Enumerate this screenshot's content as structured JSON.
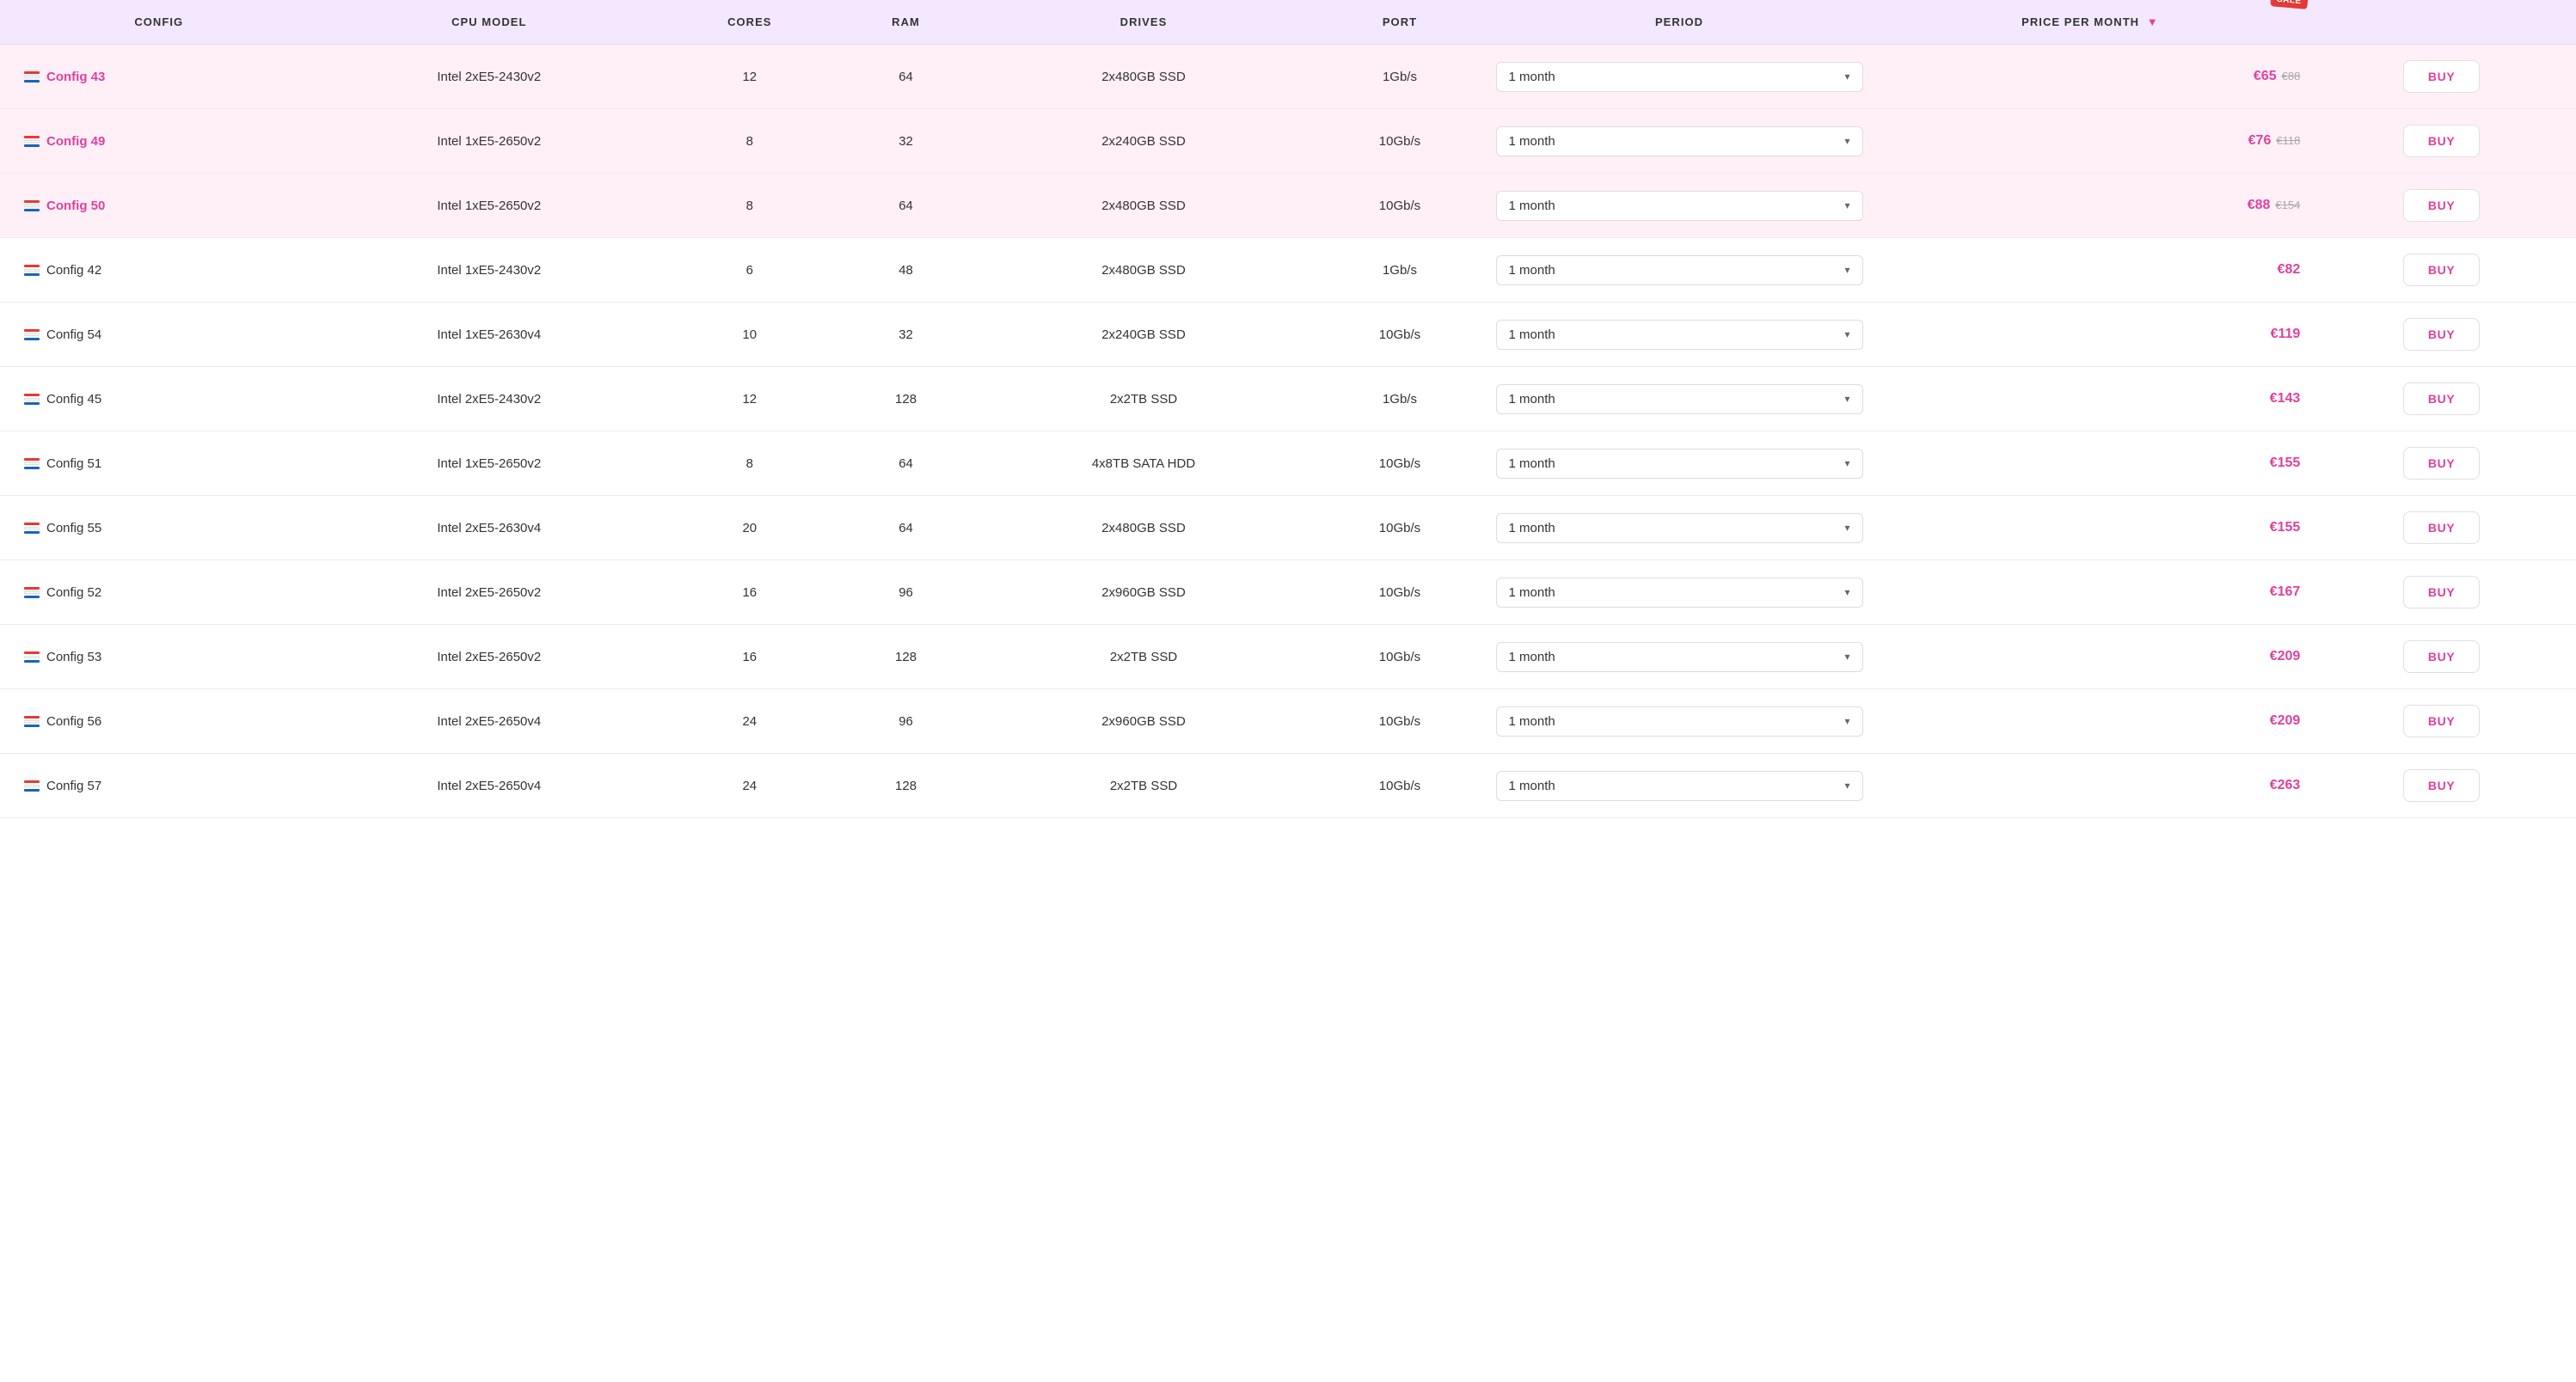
{
  "table": {
    "columns": [
      {
        "key": "config",
        "label": "CONFIG",
        "sortable": false
      },
      {
        "key": "cpu_model",
        "label": "CPU MODEL",
        "sortable": false
      },
      {
        "key": "cores",
        "label": "CORES",
        "sortable": false
      },
      {
        "key": "ram",
        "label": "RAM",
        "sortable": false
      },
      {
        "key": "drives",
        "label": "DRIVES",
        "sortable": false
      },
      {
        "key": "port",
        "label": "PORT",
        "sortable": false
      },
      {
        "key": "period",
        "label": "PERIOD",
        "sortable": false
      },
      {
        "key": "price",
        "label": "PRICE PER MONTH",
        "sortable": true
      },
      {
        "key": "action",
        "label": "",
        "sortable": false
      }
    ],
    "sale_badge": "Sale",
    "rows": [
      {
        "id": "config43",
        "config": "Config 43",
        "is_link": true,
        "highlight": true,
        "cpu_model": "Intel 2xE5-2430v2",
        "cores": "12",
        "ram": "64",
        "drives": "2x480GB SSD",
        "port": "1Gb/s",
        "period": "1 month",
        "price_current": "€65",
        "price_old": "€88",
        "buy_label": "BUY"
      },
      {
        "id": "config49",
        "config": "Config 49",
        "is_link": true,
        "highlight": true,
        "cpu_model": "Intel 1xE5-2650v2",
        "cores": "8",
        "ram": "32",
        "drives": "2x240GB SSD",
        "port": "10Gb/s",
        "period": "1 month",
        "price_current": "€76",
        "price_old": "€118",
        "buy_label": "BUY"
      },
      {
        "id": "config50",
        "config": "Config 50",
        "is_link": true,
        "highlight": true,
        "cpu_model": "Intel 1xE5-2650v2",
        "cores": "8",
        "ram": "64",
        "drives": "2x480GB SSD",
        "port": "10Gb/s",
        "period": "1 month",
        "price_current": "€88",
        "price_old": "€154",
        "buy_label": "BUY"
      },
      {
        "id": "config42",
        "config": "Config 42",
        "is_link": false,
        "highlight": false,
        "cpu_model": "Intel 1xE5-2430v2",
        "cores": "6",
        "ram": "48",
        "drives": "2x480GB SSD",
        "port": "1Gb/s",
        "period": "1 month",
        "price_current": "€82",
        "price_old": "",
        "buy_label": "BUY"
      },
      {
        "id": "config54",
        "config": "Config 54",
        "is_link": false,
        "highlight": false,
        "cpu_model": "Intel 1xE5-2630v4",
        "cores": "10",
        "ram": "32",
        "drives": "2x240GB SSD",
        "port": "10Gb/s",
        "period": "1 month",
        "price_current": "€119",
        "price_old": "",
        "buy_label": "BUY"
      },
      {
        "id": "config45",
        "config": "Config 45",
        "is_link": false,
        "highlight": false,
        "cpu_model": "Intel 2xE5-2430v2",
        "cores": "12",
        "ram": "128",
        "drives": "2x2TB SSD",
        "port": "1Gb/s",
        "period": "1 month",
        "price_current": "€143",
        "price_old": "",
        "buy_label": "BUY"
      },
      {
        "id": "config51",
        "config": "Config 51",
        "is_link": false,
        "highlight": false,
        "cpu_model": "Intel 1xE5-2650v2",
        "cores": "8",
        "ram": "64",
        "drives": "4x8TB SATA HDD",
        "port": "10Gb/s",
        "period": "1 month",
        "price_current": "€155",
        "price_old": "",
        "buy_label": "BUY"
      },
      {
        "id": "config55",
        "config": "Config 55",
        "is_link": false,
        "highlight": false,
        "cpu_model": "Intel 2xE5-2630v4",
        "cores": "20",
        "ram": "64",
        "drives": "2x480GB SSD",
        "port": "10Gb/s",
        "period": "1 month",
        "price_current": "€155",
        "price_old": "",
        "buy_label": "BUY"
      },
      {
        "id": "config52",
        "config": "Config 52",
        "is_link": false,
        "highlight": false,
        "cpu_model": "Intel 2xE5-2650v2",
        "cores": "16",
        "ram": "96",
        "drives": "2x960GB SSD",
        "port": "10Gb/s",
        "period": "1 month",
        "price_current": "€167",
        "price_old": "",
        "buy_label": "BUY"
      },
      {
        "id": "config53",
        "config": "Config 53",
        "is_link": false,
        "highlight": false,
        "cpu_model": "Intel 2xE5-2650v2",
        "cores": "16",
        "ram": "128",
        "drives": "2x2TB SSD",
        "port": "10Gb/s",
        "period": "1 month",
        "price_current": "€209",
        "price_old": "",
        "buy_label": "BUY"
      },
      {
        "id": "config56",
        "config": "Config 56",
        "is_link": false,
        "highlight": false,
        "cpu_model": "Intel 2xE5-2650v4",
        "cores": "24",
        "ram": "96",
        "drives": "2x960GB SSD",
        "port": "10Gb/s",
        "period": "1 month",
        "price_current": "€209",
        "price_old": "",
        "buy_label": "BUY"
      },
      {
        "id": "config57",
        "config": "Config 57",
        "is_link": false,
        "highlight": false,
        "cpu_model": "Intel 2xE5-2650v4",
        "cores": "24",
        "ram": "128",
        "drives": "2x2TB SSD",
        "port": "10Gb/s",
        "period": "1 month",
        "price_current": "€263",
        "price_old": "",
        "buy_label": "BUY"
      }
    ]
  }
}
